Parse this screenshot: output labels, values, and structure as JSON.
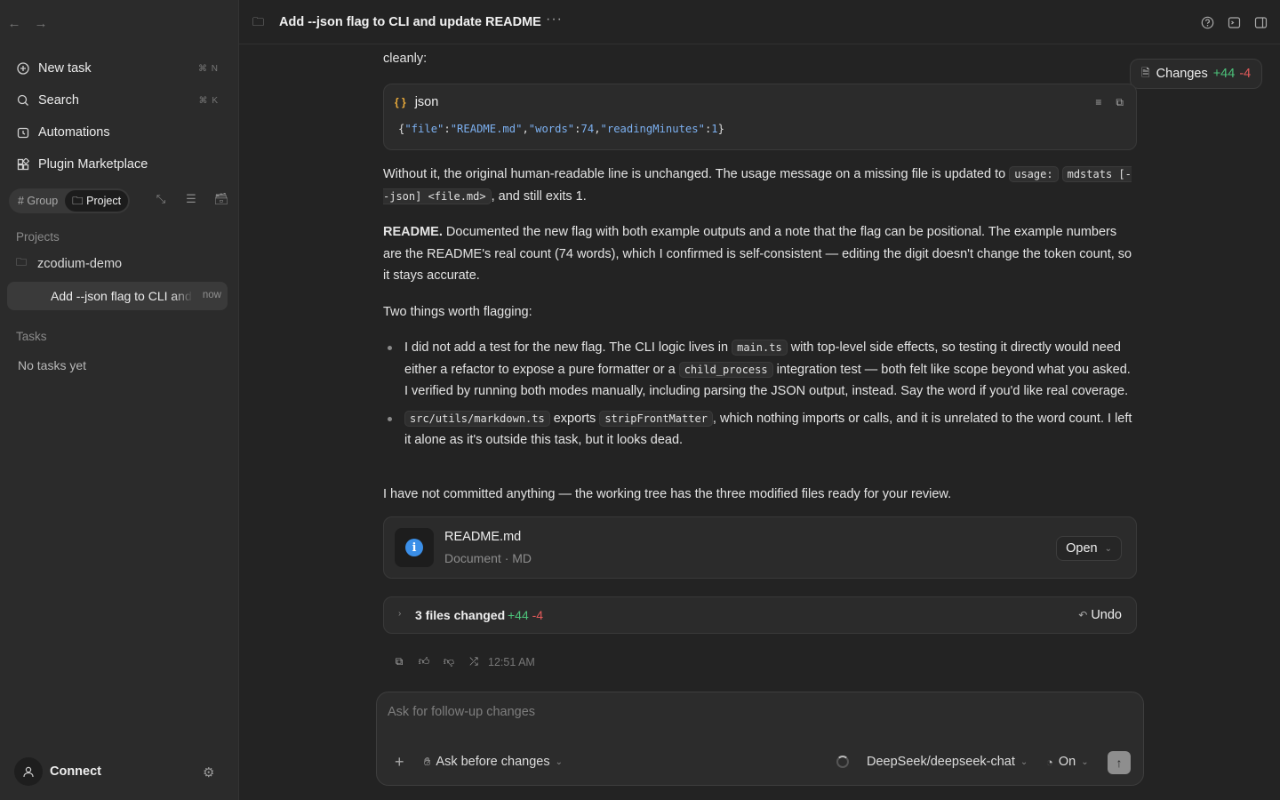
{
  "sidebar": {
    "nav": [
      {
        "label": "New task",
        "icon": "plus-circle-icon",
        "shortcut": "⌘ N"
      },
      {
        "label": "Search",
        "icon": "search-icon",
        "shortcut": "⌘ K"
      },
      {
        "label": "Automations",
        "icon": "clock-icon",
        "shortcut": ""
      },
      {
        "label": "Plugin Marketplace",
        "icon": "puzzle-icon",
        "shortcut": ""
      }
    ],
    "segments": [
      {
        "label": "# Group",
        "active": false
      },
      {
        "label": "Project",
        "active": true
      }
    ],
    "projects_header": "Projects",
    "project_name": "zcodium-demo",
    "active_task": {
      "label": "Add --json flag to CLI and update README",
      "time": "now"
    },
    "tasks_header": "Tasks",
    "no_tasks": "No tasks yet",
    "connect_label": "Connect"
  },
  "topbar": {
    "title": "Add --json flag to CLI and update README",
    "more": "···"
  },
  "changes": {
    "label": "Changes",
    "plus": "+44",
    "minus": "-4"
  },
  "message": {
    "intro_tail": "cleanly:",
    "code_lang": "json",
    "code": {
      "p1": "{",
      "k1": "\"file\"",
      "c1": ":",
      "v1": "\"README.md\"",
      "s1": ",",
      "k2": "\"words\"",
      "c2": ":",
      "v2": "74",
      "s2": ",",
      "k3": "\"readingMinutes\"",
      "c3": ":",
      "v3": "1",
      "p2": "}"
    },
    "para1_a": "Without it, the original human-readable line is unchanged. The usage message on a missing file is updated to ",
    "para1_code1": "usage:",
    "para1_code2": "mdstats [--json] <file.md>",
    "para1_b": ", and still exits 1.",
    "para2_bold": "README.",
    "para2": " Documented the new flag with both example outputs and a note that the flag can be positional. The example numbers are the README's real count (74 words), which I confirmed is self-consistent — editing the digit doesn't change the token count, so it stays accurate.",
    "para3": "Two things worth flagging:",
    "bullet1_a": "I did not add a test for the new flag. The CLI logic lives in ",
    "bullet1_code1": "main.ts",
    "bullet1_b": " with top-level side effects, so testing it directly would need either a refactor to expose a pure formatter or a ",
    "bullet1_code2": "child_process",
    "bullet1_c": " integration test — both felt like scope beyond what you asked. I verified by running both modes manually, including parsing the JSON output, instead. Say the word if you'd like real coverage.",
    "bullet2_code1": "src/utils/markdown.ts",
    "bullet2_a": " exports ",
    "bullet2_code2": "stripFrontMatter",
    "bullet2_b": ", which nothing imports or calls, and it is unrelated to the word count. I left it alone as it's outside this task, but it looks dead.",
    "para4": "I have not committed anything — the working tree has the three modified files ready for your review."
  },
  "file_card": {
    "name": "README.md",
    "meta": "Document · MD",
    "open_label": "Open"
  },
  "diff": {
    "label": "3 files changed",
    "plus": "+44",
    "minus": "-4",
    "undo_label": "Undo"
  },
  "timestamp": "12:51 AM",
  "composer": {
    "placeholder": "Ask for follow-up changes",
    "mode": "Ask before changes",
    "model": "DeepSeek/deepseek-chat",
    "thinking": "On"
  }
}
